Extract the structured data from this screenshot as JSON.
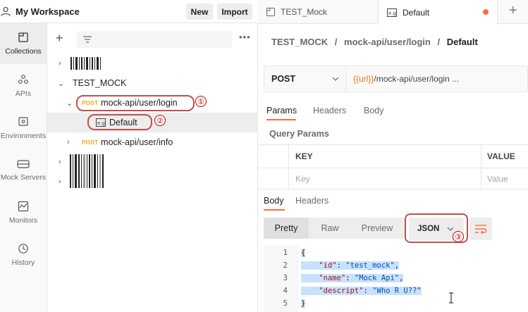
{
  "workspace": {
    "title": "My Workspace",
    "new_label": "New",
    "import_label": "Import"
  },
  "sidebar": {
    "items": [
      {
        "label": "Collections",
        "icon": "collections-icon"
      },
      {
        "label": "APIs",
        "icon": "apis-icon"
      },
      {
        "label": "Environments",
        "icon": "environments-icon"
      },
      {
        "label": "Mock Servers",
        "icon": "mock-servers-icon"
      },
      {
        "label": "Monitors",
        "icon": "monitors-icon"
      },
      {
        "label": "History",
        "icon": "history-icon"
      }
    ]
  },
  "tree": {
    "collection_name": "TEST_MOCK",
    "requests": [
      {
        "method": "POST",
        "path": "mock-api/user/login"
      },
      {
        "method": "POST",
        "path": "mock-api/user/info"
      }
    ],
    "example_name": "Default",
    "annotations": [
      "①",
      "②",
      "③"
    ]
  },
  "tabs": [
    {
      "label": "TEST_Mock"
    },
    {
      "label": "Default",
      "unsaved": true
    }
  ],
  "breadcrumb": {
    "collection": "TEST_MOCK",
    "request": "mock-api/user/login",
    "current": "Default",
    "sep": "/"
  },
  "request": {
    "method": "POST",
    "url_var": "{{url}}",
    "url_path": "/mock-api/user/login ..."
  },
  "request_tabs": {
    "params": "Params",
    "headers": "Headers",
    "body": "Body"
  },
  "query_params": {
    "title": "Query Params",
    "key_header": "KEY",
    "value_header": "VALUE",
    "key_placeholder": "Key",
    "value_placeholder": "Value"
  },
  "response_tabs": {
    "body": "Body",
    "headers": "Headers"
  },
  "response_view": {
    "pretty": "Pretty",
    "raw": "Raw",
    "preview": "Preview",
    "format": "JSON"
  },
  "code": {
    "line_numbers": [
      "1",
      "2",
      "3",
      "4",
      "5"
    ],
    "open_brace": "{",
    "close_brace": "}",
    "fields": [
      {
        "key": "\"id\"",
        "value": "\"test_mock\"",
        "trail": ","
      },
      {
        "key": "\"name\"",
        "value": "\"Mock Api\"",
        "trail": ","
      },
      {
        "key": "\"descript\"",
        "value": "\"Who R U??\"",
        "trail": ""
      }
    ]
  },
  "colors": {
    "accent": "#ff6c37",
    "post": "#f5a623",
    "annotation": "#c0504d"
  }
}
